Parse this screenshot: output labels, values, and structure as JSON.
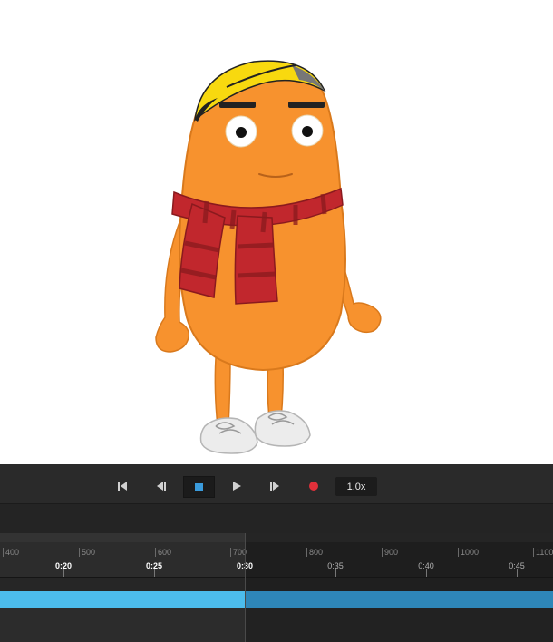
{
  "canvas": {
    "character_icon": "potato-character",
    "colors": {
      "body": "#f7922e",
      "scarf": "#c1272d",
      "hair": "#f8d90f"
    }
  },
  "playback": {
    "first_icon": "skip-to-start-icon",
    "prev_icon": "step-back-icon",
    "stop_icon": "stop-icon",
    "play_icon": "play-icon",
    "next_icon": "step-forward-icon",
    "record_icon": "record-icon",
    "speed": "1.0x",
    "accent": "#3a9bdc",
    "record_color": "#e0303a"
  },
  "timeline": {
    "frame_labels": [
      "400",
      "500",
      "600",
      "700",
      "800",
      "900",
      "1000",
      "1100"
    ],
    "time_labels": [
      "0:20",
      "0:25",
      "0:30",
      "0:35",
      "0:40",
      "0:45"
    ],
    "current_time": "0:30",
    "clip_color": "#4cbcec"
  }
}
